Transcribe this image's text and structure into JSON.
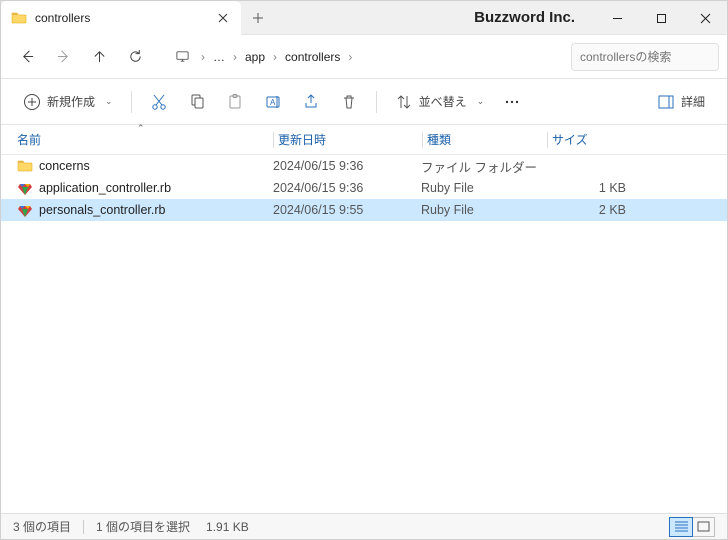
{
  "window": {
    "tab_title": "controllers",
    "brand": "Buzzword Inc."
  },
  "nav": {
    "breadcrumbs": [
      "app",
      "controllers"
    ],
    "search_placeholder": "controllersの検索"
  },
  "toolbar": {
    "new_label": "新規作成",
    "sort_label": "並べ替え",
    "details_label": "詳細"
  },
  "columns": {
    "name": "名前",
    "date": "更新日時",
    "type": "種類",
    "size": "サイズ"
  },
  "files": [
    {
      "name": "concerns",
      "date": "2024/06/15 9:36",
      "type": "ファイル フォルダー",
      "size": "",
      "icon": "folder",
      "selected": false
    },
    {
      "name": "application_controller.rb",
      "date": "2024/06/15 9:36",
      "type": "Ruby File",
      "size": "1 KB",
      "icon": "ruby",
      "selected": false
    },
    {
      "name": "personals_controller.rb",
      "date": "2024/06/15 9:55",
      "type": "Ruby File",
      "size": "2 KB",
      "icon": "ruby",
      "selected": true
    }
  ],
  "status": {
    "count": "3 個の項目",
    "selection": "1 個の項目を選択",
    "size": "1.91 KB"
  }
}
